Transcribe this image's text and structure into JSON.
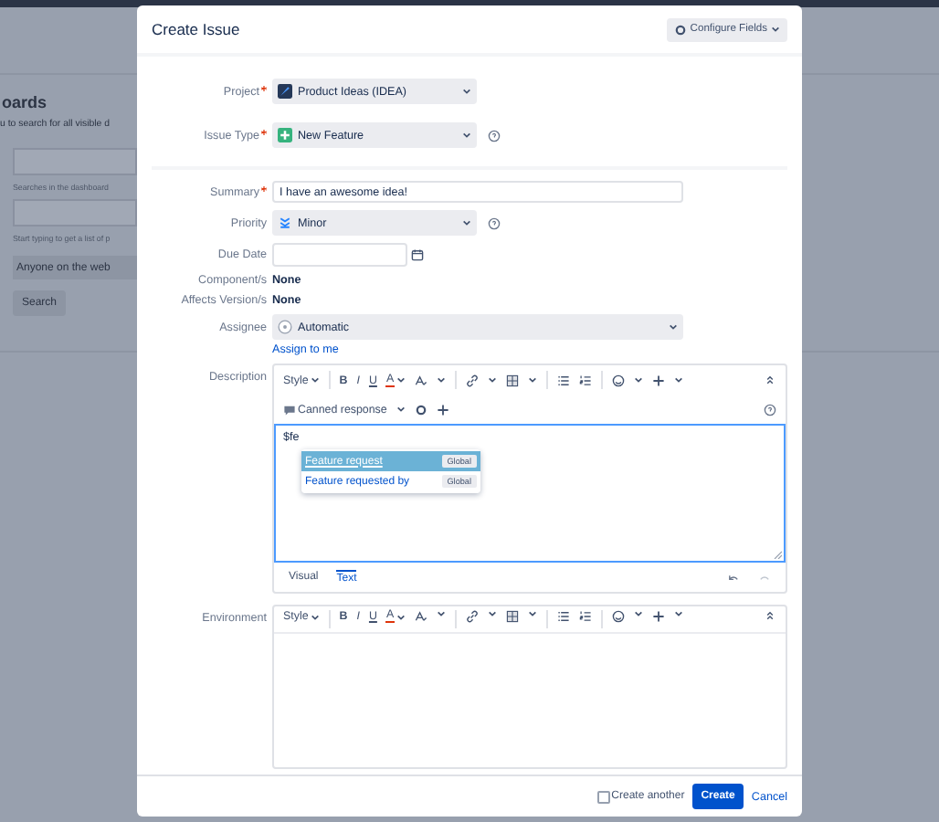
{
  "background_page": {
    "heading": "oards",
    "intro": "u to search for all visible d",
    "hints": [
      "Searches in the dashboard",
      "Start typing to get a list of p"
    ],
    "share_select": "Anyone on the web",
    "search_button": "Search"
  },
  "dialog": {
    "title": "Create Issue",
    "configure_button": "Configure Fields"
  },
  "fields": [
    {
      "kind": "project",
      "label": "Project",
      "required": true,
      "value": "Product Ideas (IDEA)",
      "help": false
    },
    {
      "kind": "issuetype",
      "label": "Issue Type",
      "required": true,
      "value": "New Feature",
      "help": true
    },
    {
      "kind": "text",
      "label": "Summary",
      "required": true,
      "value": "I have an awesome idea!",
      "help": false
    },
    {
      "kind": "priority",
      "label": "Priority",
      "required": false,
      "value": "Minor",
      "help": true
    },
    {
      "kind": "date",
      "label": "Due Date",
      "required": false,
      "help": false
    },
    {
      "kind": "static",
      "label": "Component/s",
      "required": false,
      "value": "None",
      "help": false
    },
    {
      "kind": "static",
      "label": "Affects Version/s",
      "required": false,
      "value": "None",
      "help": false
    },
    {
      "kind": "assignee",
      "label": "Assignee",
      "required": false,
      "value": "Automatic",
      "help": false,
      "link": "Assign to me"
    }
  ],
  "description": {
    "label": "Description",
    "toolbar": {
      "style": "Style",
      "bold": "B",
      "italic": "I",
      "underline": "U",
      "font_color": "A"
    },
    "canned_response": "Canned response",
    "text": "$fe",
    "suggestions": [
      {
        "label": "Feature request",
        "tag": "Global",
        "selected": true
      },
      {
        "label": "Feature requested by",
        "tag": "Global",
        "selected": false
      }
    ],
    "tabs": [
      {
        "label": "Visual",
        "selected": false
      },
      {
        "label": "Text",
        "selected": true
      }
    ]
  },
  "environment": {
    "label": "Environment",
    "toolbar": {
      "style": "Style",
      "bold": "B",
      "italic": "I",
      "underline": "U",
      "font_color": "A"
    }
  },
  "footer": {
    "create_another": {
      "label": "Create another",
      "checked": false
    },
    "create_button": "Create",
    "cancel_link": "Cancel"
  }
}
